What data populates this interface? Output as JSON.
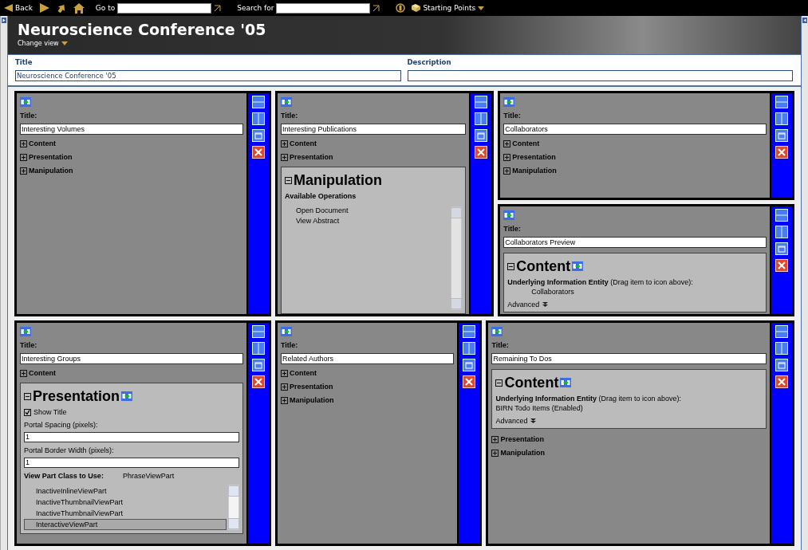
{
  "toolbar": {
    "back": "Back",
    "goto_label": "Go to",
    "search_label": "Search for",
    "starting_points": "Starting Points"
  },
  "header": {
    "title": "Neuroscience Conference '05",
    "change_view": "Change view"
  },
  "properties": [
    {
      "label": "Title",
      "value": "Neuroscience Conference '05"
    },
    {
      "label": "Description"
    }
  ],
  "rows": [
    {
      "columns": [
        {
          "portlets": [
            {
              "title_label": "Title:",
              "title_value": "Interesting Volumes",
              "sections": [
                {
                  "kind": "collapsed",
                  "label": "Content"
                },
                {
                  "kind": "collapsed",
                  "label": "Presentation"
                },
                {
                  "kind": "collapsed",
                  "label": "Manipulation"
                }
              ]
            }
          ]
        },
        {
          "portlets": [
            {
              "title_label": "Title:",
              "title_value": "Interesting Publications",
              "sections": [
                {
                  "kind": "collapsed",
                  "label": "Content"
                },
                {
                  "kind": "collapsed",
                  "label": "Presentation"
                },
                {
                  "kind": "operations",
                  "label": "Manipulation",
                  "heading": "Available Operations",
                  "items": [
                    "Open Document",
                    "View Abstract"
                  ]
                }
              ]
            }
          ]
        },
        {
          "portlets": [
            {
              "title_label": "Title:",
              "title_value": "Collaborators",
              "sections": [
                {
                  "kind": "collapsed",
                  "label": "Content"
                },
                {
                  "kind": "collapsed",
                  "label": "Presentation"
                },
                {
                  "kind": "collapsed",
                  "label": "Manipulation"
                }
              ]
            },
            {
              "title_label": "Title:",
              "title_value": "Collaborators Preview",
              "sections": [
                {
                  "kind": "entity",
                  "label": "Content",
                  "entity_label": "**Underlying Information Entity** (Drag item to icon above):",
                  "entity_value": "Collaborators",
                  "advanced": "Advanced"
                }
              ]
            }
          ]
        }
      ]
    },
    {
      "columns": [
        {
          "portlets": [
            {
              "title_label": "Title:",
              "title_value": "Interesting Groups",
              "sections": [
                {
                  "kind": "collapsed",
                  "label": "Content"
                },
                {
                  "kind": "presentation",
                  "label": "Presentation",
                  "show_title": {
                    "label": "Show Title",
                    "checked": true
                  },
                  "fields": [
                    {
                      "label": "Portal Spacing (pixels):",
                      "value": "1"
                    },
                    {
                      "label": "Portal Border Width (pixels):",
                      "value": "1"
                    }
                  ],
                  "class_label": "View Part Class to Use:",
                  "class_value": "PhraseViewPart",
                  "classes": [
                    {
                      "name": "InactiveInlineViewPart",
                      "selected": false
                    },
                    {
                      "name": "InactiveThumbnailViewPart",
                      "selected": false
                    },
                    {
                      "name": "InactiveThumbnailViewPart",
                      "selected": false
                    },
                    {
                      "name": "InteractiveViewPart",
                      "selected": true
                    }
                  ]
                }
              ]
            }
          ]
        },
        {
          "portlets": [
            {
              "title_label": "Title:",
              "title_value": "Related Authors",
              "sections": [
                {
                  "kind": "collapsed",
                  "label": "Content"
                },
                {
                  "kind": "collapsed",
                  "label": "Presentation"
                },
                {
                  "kind": "collapsed",
                  "label": "Manipulation"
                }
              ]
            }
          ]
        },
        {
          "portlets": [
            {
              "title_label": "Title:",
              "title_value": "Remaining To Dos",
              "sections": [
                {
                  "kind": "entity",
                  "label": "Content",
                  "entity_label": "**Underlying Information Entity** (Drag item to icon above):",
                  "entity_value": "BIRN Todo Items (Enabled)",
                  "advanced": "Advanced"
                },
                {
                  "kind": "collapsed",
                  "label": "Presentation"
                },
                {
                  "kind": "collapsed",
                  "label": "Manipulation"
                }
              ]
            }
          ]
        }
      ]
    }
  ]
}
